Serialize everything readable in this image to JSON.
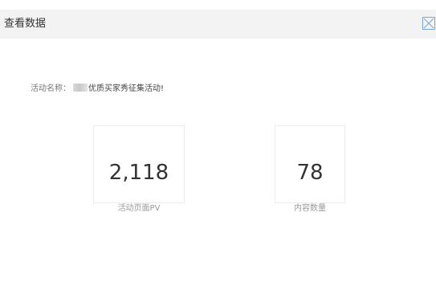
{
  "dialog": {
    "title": "查看数据",
    "close_icon": "close-icon"
  },
  "activity": {
    "label": "活动名称：",
    "name": "优质买家秀征集活动!"
  },
  "stats": [
    {
      "value": "2,118",
      "label": "活动页面PV"
    },
    {
      "value": "78",
      "label": "内容数量"
    }
  ],
  "colors": {
    "titlebar_bg": "#f3f3f3",
    "close_icon": "#7aa7d6",
    "card_border": "#ececec"
  }
}
